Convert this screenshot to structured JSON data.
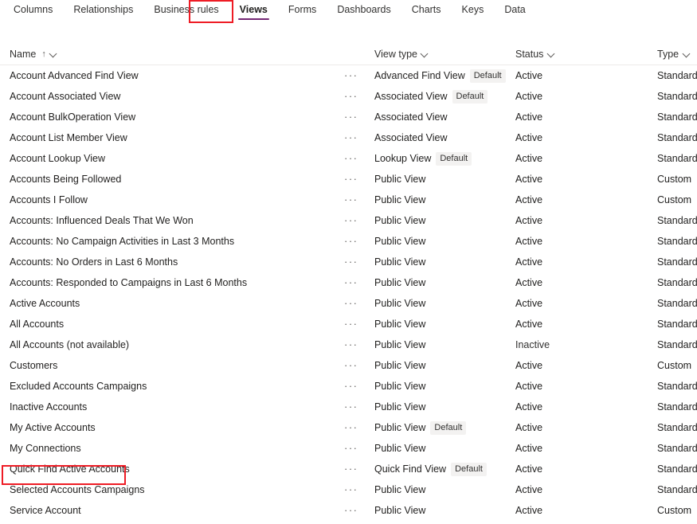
{
  "tabs": [
    {
      "label": "Columns",
      "selected": false
    },
    {
      "label": "Relationships",
      "selected": false
    },
    {
      "label": "Business rules",
      "selected": false
    },
    {
      "label": "Views",
      "selected": true
    },
    {
      "label": "Forms",
      "selected": false
    },
    {
      "label": "Dashboards",
      "selected": false
    },
    {
      "label": "Charts",
      "selected": false
    },
    {
      "label": "Keys",
      "selected": false
    },
    {
      "label": "Data",
      "selected": false
    }
  ],
  "annotations": {
    "color": "#ee1c25",
    "views_tab": "Views",
    "quick_find_row": "Quick Find Active Accounts"
  },
  "accent_color": "#742774",
  "grid": {
    "columns": [
      {
        "label": "Name",
        "sort": "↑",
        "has_menu": true
      },
      {
        "label": "View type",
        "sort": "",
        "has_menu": true
      },
      {
        "label": "Status",
        "sort": "",
        "has_menu": true
      },
      {
        "label": "Type",
        "sort": "",
        "has_menu": true
      }
    ],
    "more_icon": "···",
    "default_badge": "Default",
    "rows": [
      {
        "name": "Account Advanced Find View",
        "view_type": "Advanced Find View",
        "default": true,
        "status": "Active",
        "type": "Standard"
      },
      {
        "name": "Account Associated View",
        "view_type": "Associated View",
        "default": true,
        "status": "Active",
        "type": "Standard"
      },
      {
        "name": "Account BulkOperation View",
        "view_type": "Associated View",
        "default": false,
        "status": "Active",
        "type": "Standard"
      },
      {
        "name": "Account List Member View",
        "view_type": "Associated View",
        "default": false,
        "status": "Active",
        "type": "Standard"
      },
      {
        "name": "Account Lookup View",
        "view_type": "Lookup View",
        "default": true,
        "status": "Active",
        "type": "Standard"
      },
      {
        "name": "Accounts Being Followed",
        "view_type": "Public View",
        "default": false,
        "status": "Active",
        "type": "Custom"
      },
      {
        "name": "Accounts I Follow",
        "view_type": "Public View",
        "default": false,
        "status": "Active",
        "type": "Custom"
      },
      {
        "name": "Accounts: Influenced Deals That We Won",
        "view_type": "Public View",
        "default": false,
        "status": "Active",
        "type": "Standard"
      },
      {
        "name": "Accounts: No Campaign Activities in Last 3 Months",
        "view_type": "Public View",
        "default": false,
        "status": "Active",
        "type": "Standard"
      },
      {
        "name": "Accounts: No Orders in Last 6 Months",
        "view_type": "Public View",
        "default": false,
        "status": "Active",
        "type": "Standard"
      },
      {
        "name": "Accounts: Responded to Campaigns in Last 6 Months",
        "view_type": "Public View",
        "default": false,
        "status": "Active",
        "type": "Standard"
      },
      {
        "name": "Active Accounts",
        "view_type": "Public View",
        "default": false,
        "status": "Active",
        "type": "Standard"
      },
      {
        "name": "All Accounts",
        "view_type": "Public View",
        "default": false,
        "status": "Active",
        "type": "Standard"
      },
      {
        "name": "All Accounts (not available)",
        "view_type": "Public View",
        "default": false,
        "status": "Inactive",
        "type": "Standard"
      },
      {
        "name": "Customers",
        "view_type": "Public View",
        "default": false,
        "status": "Active",
        "type": "Custom"
      },
      {
        "name": "Excluded Accounts Campaigns",
        "view_type": "Public View",
        "default": false,
        "status": "Active",
        "type": "Standard"
      },
      {
        "name": "Inactive Accounts",
        "view_type": "Public View",
        "default": false,
        "status": "Active",
        "type": "Standard"
      },
      {
        "name": "My Active Accounts",
        "view_type": "Public View",
        "default": true,
        "status": "Active",
        "type": "Standard"
      },
      {
        "name": "My Connections",
        "view_type": "Public View",
        "default": false,
        "status": "Active",
        "type": "Standard"
      },
      {
        "name": "Quick Find Active Accounts",
        "view_type": "Quick Find View",
        "default": true,
        "status": "Active",
        "type": "Standard"
      },
      {
        "name": "Selected Accounts Campaigns",
        "view_type": "Public View",
        "default": false,
        "status": "Active",
        "type": "Standard"
      },
      {
        "name": "Service Account",
        "view_type": "Public View",
        "default": false,
        "status": "Active",
        "type": "Custom"
      }
    ]
  }
}
